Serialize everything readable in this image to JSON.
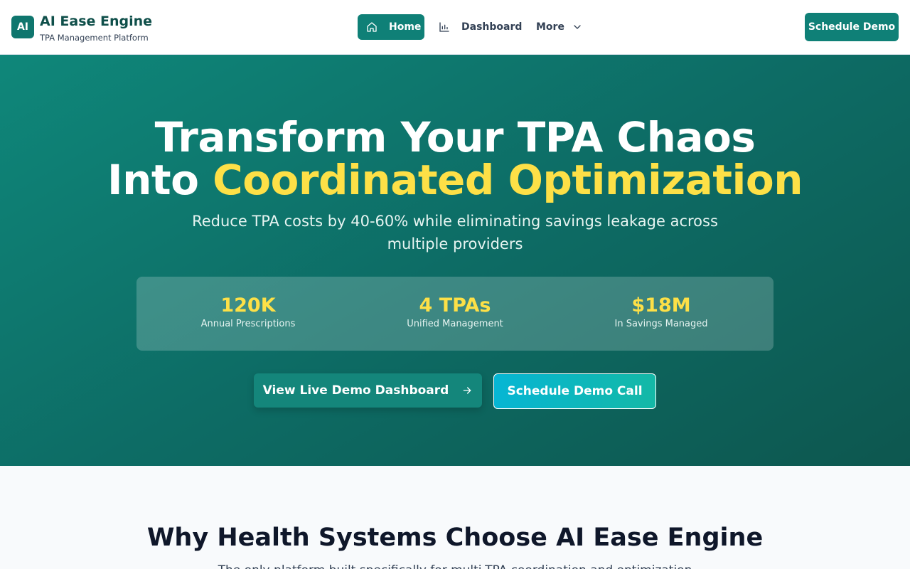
{
  "brand": {
    "badge": "AI",
    "title": "AI Ease Engine",
    "subtitle": "TPA Management Platform"
  },
  "nav": {
    "home": {
      "label": "Home",
      "icon": "home-icon",
      "active": true
    },
    "dashboard": {
      "label": "Dashboard",
      "icon": "bar-chart-icon"
    },
    "more": {
      "label": "More",
      "icon": "chevron-down-icon"
    }
  },
  "header_cta": {
    "label": "Schedule Demo"
  },
  "hero": {
    "title_line1": "Transform Your TPA Chaos",
    "title_line2_prefix": "Into ",
    "title_line2_highlight": "Coordinated Optimization",
    "subtitle": "Reduce TPA costs by 40-60% while eliminating savings leakage across multiple providers",
    "stats": [
      {
        "value": "120K",
        "label": "Annual Prescriptions"
      },
      {
        "value": "4 TPAs",
        "label": "Unified Management"
      },
      {
        "value": "$18M",
        "label": "In Savings Managed"
      }
    ],
    "primary_button": {
      "label": "View Live Demo Dashboard",
      "icon": "arrow-right-icon"
    },
    "secondary_button": {
      "label": "Schedule Demo Call"
    }
  },
  "section": {
    "title": "Why Health Systems Choose AI Ease Engine",
    "subtitle": "The only platform built specifically for multi-TPA coordination and optimization"
  },
  "colors": {
    "brand_teal": "#0f8077",
    "highlight_yellow": "#fde047",
    "hero_gradient_start": "#0f877a",
    "hero_gradient_end": "#0d574f",
    "call_button_start": "#06b6d4",
    "call_button_end": "#14b8a6"
  }
}
